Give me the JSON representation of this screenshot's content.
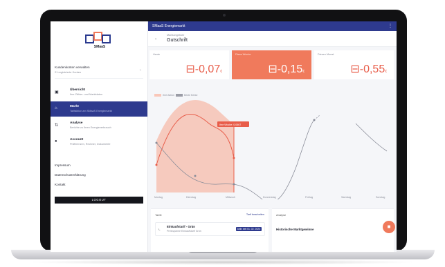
{
  "app": {
    "title": "SMaaS Energiemarkt",
    "logo_text": "SMaaS"
  },
  "sidebar": {
    "customer_label": "Kundenkonten verwalten",
    "customer_sub": "21 registrierte Konten",
    "items": [
      {
        "label": "Übersicht",
        "sub": "Ihre Zähler- und Marktdaten",
        "icon": "grid-icon"
      },
      {
        "label": "Markt",
        "sub": "Tarifaktion am SMaaS Energiemarkt",
        "icon": "market-icon"
      },
      {
        "label": "Analyse",
        "sub": "Berichte zu Ihren Energieverbrauch",
        "icon": "chart-icon"
      },
      {
        "label": "Account",
        "sub": "Präferenzen, Rechner, Dokumente",
        "icon": "account-icon"
      }
    ],
    "links": [
      "Impressum",
      "Datenschutzerklärung",
      "Kontakt"
    ],
    "logout_label": "LOGOUT"
  },
  "header": {
    "small": "Marktangebote",
    "big": "Gutschrift"
  },
  "cards": [
    {
      "label": "Heute",
      "value": "-0,07",
      "unit": "€"
    },
    {
      "label": "Diese Woche",
      "value": "-0,15",
      "unit": "€"
    },
    {
      "label": "Diesen Monat",
      "value": "-0,55",
      "unit": "€"
    }
  ],
  "chart": {
    "legend": [
      "Ihre Aktion",
      "Beste Börse"
    ],
    "tooltip": "Ihre Woche: 0,0667",
    "x_ticks": [
      "Montag",
      "Dienstag",
      "Mittwoch",
      "Donnerstag",
      "Freitag",
      "Samstag",
      "Sonntag"
    ]
  },
  "chart_data": {
    "type": "line",
    "categories": [
      "Montag",
      "Dienstag",
      "Mittwoch",
      "Donnerstag",
      "Freitag",
      "Samstag",
      "Sonntag"
    ],
    "series": [
      {
        "name": "Ihre Aktion",
        "values": [
          0.3,
          0.36,
          0.27,
          0.18,
          0.24,
          0.34,
          0.28
        ]
      },
      {
        "name": "Beste Börse",
        "values": [
          0.28,
          0.23,
          0.18,
          0.14,
          0.2,
          0.25,
          0.22
        ]
      }
    ]
  },
  "panels": {
    "tarife_title": "Tarife",
    "tarife_link": "Tarif bearbeiten",
    "tariff_name": "Einkaufstarif - Grün",
    "tariff_sub": "Preisspanne Einkaufstarif Grün",
    "tariff_badge": "Aktiv seit 01. 02. 2024",
    "analyse_title": "Analyse",
    "analyse_item": "Historische Marktgewinne"
  },
  "colors": {
    "accent": "#f07a5c",
    "primary": "#2e3a8e",
    "value": "#e85d4a"
  }
}
